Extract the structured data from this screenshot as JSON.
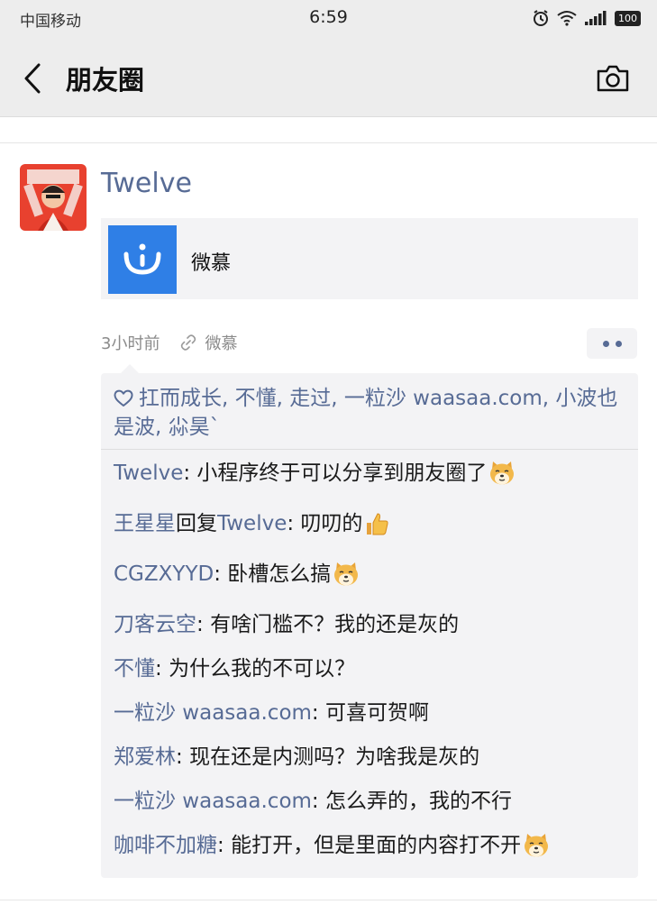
{
  "status_bar": {
    "carrier": "中国移动",
    "time": "6:59",
    "battery": "100"
  },
  "nav": {
    "title": "朋友圈"
  },
  "post": {
    "author": "Twelve",
    "share_card": {
      "title": "微慕"
    },
    "time": "3小时前",
    "source": "微慕",
    "likes": "扛而成长, 不懂, 走过, 一粒沙 waasaa.com, 小波也是波, 尛昊`",
    "comments": [
      {
        "name": "Twelve",
        "reply_word": "",
        "reply_to": "",
        "sep": ": ",
        "text": "小程序终于可以分享到朋友圈了",
        "emoji": "doge-emoji"
      },
      {
        "name": "王星星",
        "reply_word": "回复",
        "reply_to": "Twelve",
        "sep": ": ",
        "text": "叨叨的",
        "emoji": "thumbs-up-emoji"
      },
      {
        "name": "CGZXYYD",
        "reply_word": "",
        "reply_to": "",
        "sep": ": ",
        "text": "卧槽怎么搞",
        "emoji": "doge-emoji"
      },
      {
        "name": "刀客云空",
        "reply_word": "",
        "reply_to": "",
        "sep": ": ",
        "text": "有啥门槛不？我的还是灰的",
        "emoji": ""
      },
      {
        "name": "不懂",
        "reply_word": "",
        "reply_to": "",
        "sep": ": ",
        "text": "为什么我的不可以？",
        "emoji": ""
      },
      {
        "name": "一粒沙 waasaa.com",
        "reply_word": "",
        "reply_to": "",
        "sep": ": ",
        "text": "可喜可贺啊",
        "emoji": ""
      },
      {
        "name": "郑爱林",
        "reply_word": "",
        "reply_to": "",
        "sep": ": ",
        "text": "现在还是内测吗？为啥我是灰的",
        "emoji": ""
      },
      {
        "name": "一粒沙 waasaa.com",
        "reply_word": "",
        "reply_to": "",
        "sep": ": ",
        "text": "怎么弄的，我的不行",
        "emoji": ""
      },
      {
        "name": "咖啡不加糖",
        "reply_word": "",
        "reply_to": "",
        "sep": ": ",
        "text": "能打开，但是里面的内容打不开",
        "emoji": "doge-emoji"
      }
    ]
  },
  "colors": {
    "link": "#576b95",
    "bar_background": "#ededed",
    "card_background": "#f3f3f5",
    "share_thumb": "#2f7fe6"
  }
}
